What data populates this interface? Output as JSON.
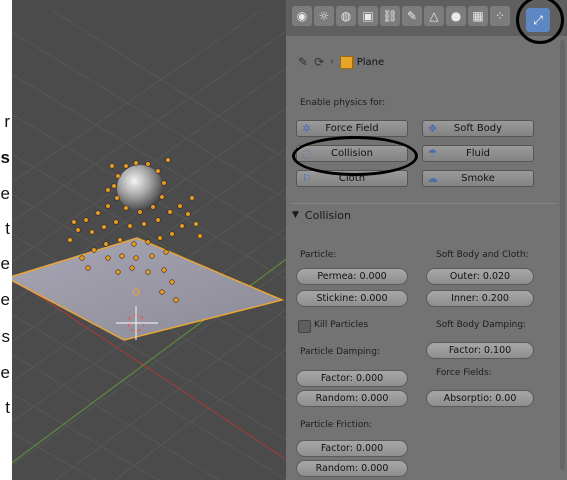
{
  "document_fragments": {
    "items": [
      {
        "text": "r",
        "bold": false
      },
      {
        "text": "s",
        "bold": true
      },
      {
        "text": "e",
        "bold": false
      },
      {
        "text": "t",
        "bold": false
      },
      {
        "text": "e",
        "bold": false
      },
      {
        "text": "e",
        "bold": false
      },
      {
        "text": "s",
        "bold": false
      },
      {
        "text": "e",
        "bold": false
      },
      {
        "text": "t",
        "bold": false
      }
    ]
  },
  "toolbar": {
    "tabs": [
      {
        "name": "render-tab",
        "icon": "camera-icon",
        "glyph": "◉"
      },
      {
        "name": "scene-tab",
        "icon": "scene-icon",
        "glyph": "☼"
      },
      {
        "name": "world-tab",
        "icon": "world-icon",
        "glyph": "◍"
      },
      {
        "name": "object-tab",
        "icon": "object-icon",
        "glyph": "▣"
      },
      {
        "name": "constraints-tab",
        "icon": "constraint-icon",
        "glyph": "⛓"
      },
      {
        "name": "modifiers-tab",
        "icon": "wrench-icon",
        "glyph": "✎"
      },
      {
        "name": "data-tab",
        "icon": "mesh-icon",
        "glyph": "△"
      },
      {
        "name": "material-tab",
        "icon": "material-icon",
        "glyph": "●"
      },
      {
        "name": "texture-tab",
        "icon": "texture-icon",
        "glyph": "▦"
      },
      {
        "name": "particles-tab",
        "icon": "particles-icon",
        "glyph": "⁘"
      },
      {
        "name": "physics-tab",
        "icon": "physics-icon",
        "glyph": "⤢",
        "active": true
      }
    ]
  },
  "context": {
    "object_name": "Plane"
  },
  "physics": {
    "enable_label": "Enable physics for:",
    "buttons": [
      {
        "label": "Force Field",
        "icon": "force-field-icon",
        "glyph": "✲"
      },
      {
        "label": "Soft Body",
        "icon": "soft-body-icon",
        "glyph": "❖"
      },
      {
        "label": "Collision",
        "icon": "collision-icon",
        "glyph": "◌"
      },
      {
        "label": "Fluid",
        "icon": "fluid-icon",
        "glyph": "☂"
      },
      {
        "label": "Cloth",
        "icon": "cloth-icon",
        "glyph": "⚐"
      },
      {
        "label": "Smoke",
        "icon": "smoke-icon",
        "glyph": "☁"
      }
    ]
  },
  "collision_panel": {
    "title": "Collision",
    "particle_label": "Particle:",
    "permea": "Permea: 0.000",
    "stickiness": "Stickine: 0.000",
    "kill_particles": "Kill Particles",
    "particle_damping_label": "Particle Damping:",
    "damping_factor": "Factor: 0.000",
    "damping_random": "Random: 0.000",
    "particle_friction_label": "Particle Friction:",
    "friction_factor": "Factor: 0.000",
    "friction_random": "Random: 0.000",
    "soft_body_cloth_label": "Soft Body and Cloth:",
    "outer": "Outer: 0.020",
    "inner": "Inner: 0.200",
    "soft_body_damping_label": "Soft Body Damping:",
    "sb_factor": "Factor: 0.100",
    "force_fields_label": "Force Fields:",
    "absorption": "Absorptio: 0.00"
  }
}
